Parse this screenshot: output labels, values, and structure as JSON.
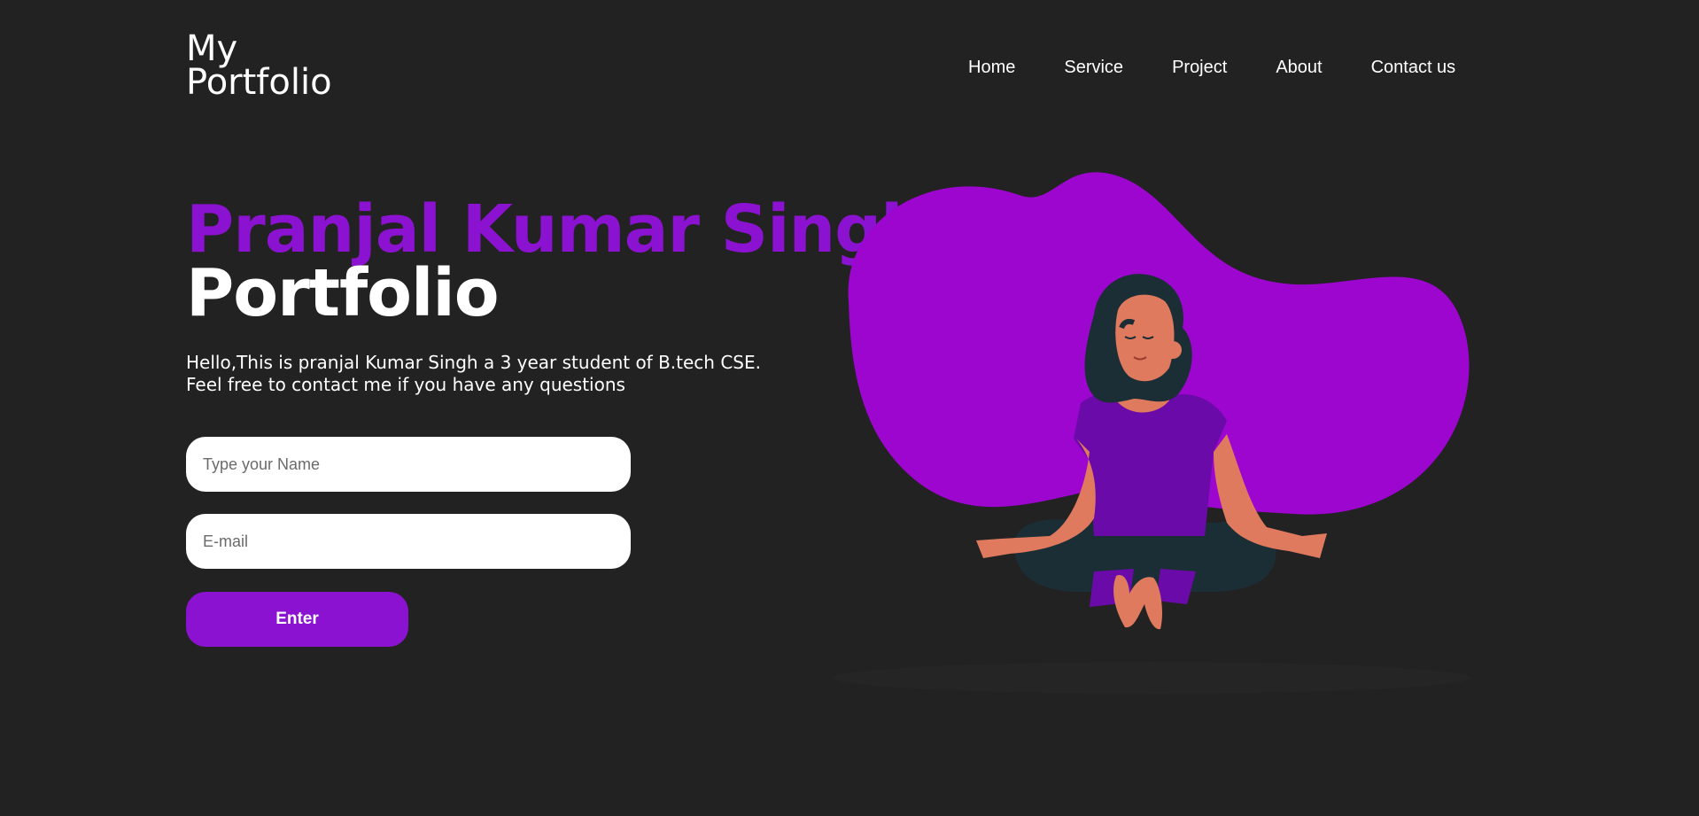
{
  "header": {
    "logo_line1": "My",
    "logo_line2": "Portfolio",
    "nav": [
      {
        "label": "Home"
      },
      {
        "label": "Service"
      },
      {
        "label": "Project"
      },
      {
        "label": "About"
      },
      {
        "label": "Contact us"
      }
    ]
  },
  "hero": {
    "name": "Pranjal Kumar Singh",
    "subtitle": "Portfolio",
    "intro_line1": "Hello,This is pranjal Kumar Singh a 3 year student of B.tech CSE.",
    "intro_line2": "Feel free to contact me if you have any questions"
  },
  "form": {
    "name_placeholder": "Type your Name",
    "name_value": "",
    "email_placeholder": "E-mail",
    "email_value": "",
    "submit_label": "Enter"
  },
  "colors": {
    "background": "#222222",
    "accent": "#8b12d0",
    "blob": "#9d06cf",
    "text": "#ffffff"
  },
  "icons": {
    "illustration": "meditating-woman-illustration"
  }
}
